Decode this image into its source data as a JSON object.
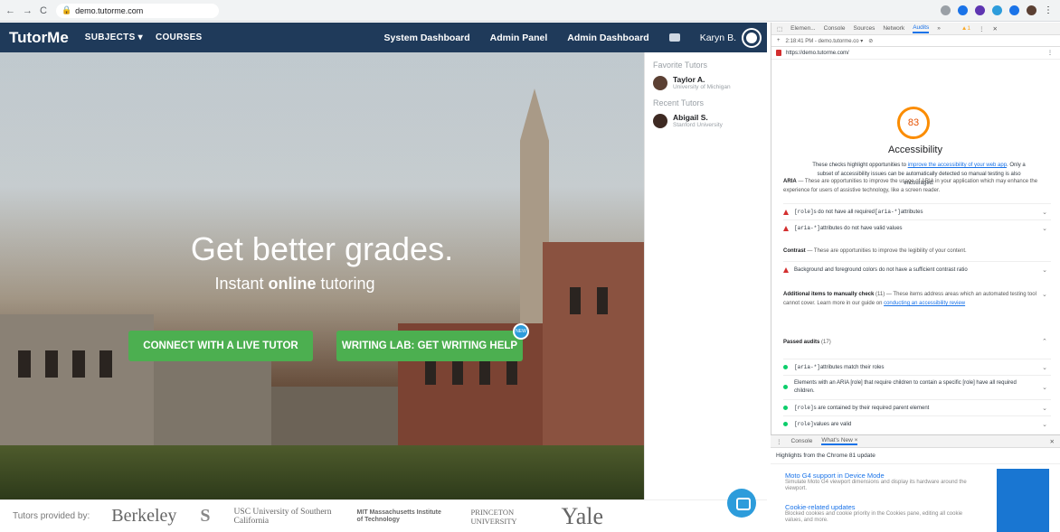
{
  "browser": {
    "url": "demo.tutorme.com",
    "nav_back": "←",
    "nav_forward": "→",
    "nav_reload": "C"
  },
  "site": {
    "logo": "TutorMe",
    "nav_left": [
      "SUBJECTS ▾",
      "COURSES"
    ],
    "nav_right": [
      "System Dashboard",
      "Admin Panel",
      "Admin Dashboard"
    ],
    "user_name": "Karyn B.",
    "hero_title": "Get better grades.",
    "hero_sub_prefix": "Instant ",
    "hero_sub_bold": "online",
    "hero_sub_suffix": " tutoring",
    "btn_live": "CONNECT WITH A LIVE TUTOR",
    "btn_writing": "WRITING LAB: GET WRITING HELP",
    "new_badge": "NEW",
    "favorite_heading": "Favorite Tutors",
    "recent_heading": "Recent Tutors",
    "favorite_tutors": [
      {
        "name": "Taylor A.",
        "school": "University of Michigan"
      }
    ],
    "recent_tutors": [
      {
        "name": "Abigail S.",
        "school": "Stanford University"
      }
    ],
    "footer_label": "Tutors provided by:",
    "universities": [
      "Berkeley",
      "S",
      "USC University of Southern California",
      "MIT Massachusetts Institute of Technology",
      "PRINCETON UNIVERSITY",
      "Yale"
    ]
  },
  "devtools": {
    "tabs": [
      "Elemen...",
      "Console",
      "Sources",
      "Network",
      "Audits",
      "»"
    ],
    "active_tab": "Audits",
    "warnings": "▲1",
    "sub_time": "2:18:41 PM - demo.tutorme.co ▾",
    "audited_url": "https://demo.tutorme.com/",
    "score": "83",
    "section_title": "Accessibility",
    "desc_a": "These checks highlight opportunities to ",
    "desc_link": "improve the accessibility of your web app",
    "desc_b": ". Only a subset of accessibility issues can be automatically detected so manual testing is also encouraged.",
    "aria_head": "ARIA",
    "aria_text": " — These are opportunities to improve the usage of ARIA in your application which may enhance the experience for users of assistive technology, like a screen reader.",
    "aria_fail": [
      {
        "code": "[role]",
        "text": "s do not have all required ",
        "code2": "[aria-*]",
        "tail": " attributes"
      },
      {
        "code": "[aria-*]",
        "text": " attributes do not have valid values",
        "code2": "",
        "tail": ""
      }
    ],
    "contrast_head": "Contrast",
    "contrast_text": " — These are opportunities to improve the legibility of your content.",
    "contrast_fail": "Background and foreground colors do not have a sufficient contrast ratio",
    "manual_head": "Additional items to manually check",
    "manual_count": " (11)",
    "manual_text": " — These items address areas which an automated testing tool cannot cover. Learn more in our guide on ",
    "manual_link": "conducting an accessibility review",
    "passed_head": "Passed audits",
    "passed_count": " (17)",
    "passed": [
      {
        "code": "[aria-*]",
        "text": " attributes match their roles"
      },
      {
        "code": "",
        "text": "Elements with an ARIA [role] that require children to contain a specific [role] have all required children."
      },
      {
        "code": "[role]",
        "text": "s are contained by their required parent element"
      },
      {
        "code": "[role]",
        "text": " values are valid"
      }
    ],
    "drawer_tabs": [
      "Console",
      "What's New ×"
    ],
    "drawer_heading": "Highlights from the Chrome 81 update",
    "whatsnew": [
      {
        "title": "Moto G4 support in Device Mode",
        "desc": "Simulate Moto G4 viewport dimensions and display its hardware around the viewport."
      },
      {
        "title": "Cookie-related updates",
        "desc": "Blocked cookies and cookie priority in the Cookies pane, editing all cookie values, and more."
      }
    ]
  }
}
